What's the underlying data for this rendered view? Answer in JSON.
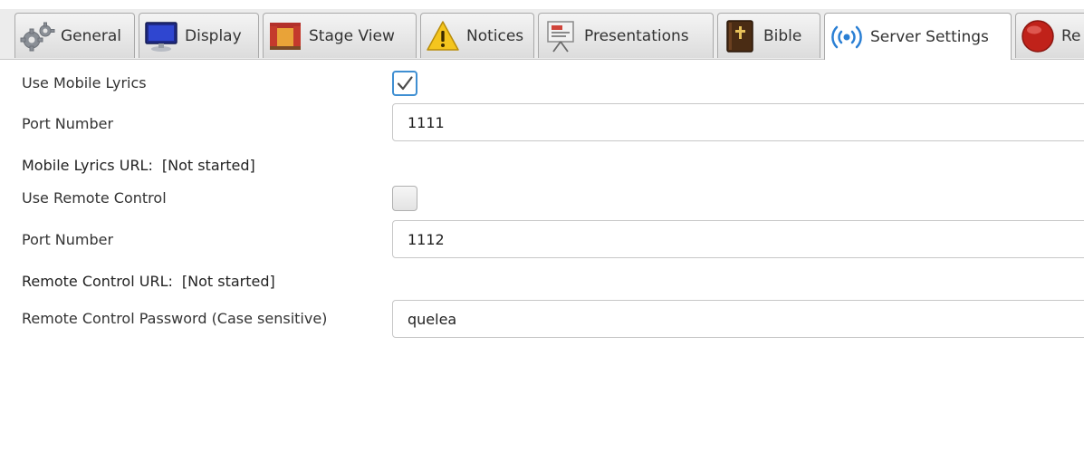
{
  "tabs": [
    {
      "label": "General",
      "icon": "gears-icon"
    },
    {
      "label": "Display",
      "icon": "monitor-icon"
    },
    {
      "label": "Stage View",
      "icon": "stage-icon"
    },
    {
      "label": "Notices",
      "icon": "warning-icon"
    },
    {
      "label": "Presentations",
      "icon": "presentation-icon"
    },
    {
      "label": "Bible",
      "icon": "bible-icon"
    },
    {
      "label": "Server Settings",
      "icon": "broadcast-icon",
      "active": true
    },
    {
      "label": "Re",
      "icon": "record-icon"
    }
  ],
  "server": {
    "use_mobile_lyrics_label": "Use Mobile Lyrics",
    "use_mobile_lyrics_checked": true,
    "mobile_port_label": "Port Number",
    "mobile_port_value": "1111",
    "mobile_url_label": "Mobile Lyrics URL:",
    "mobile_url_value": "[Not started]",
    "use_remote_control_label": "Use Remote Control",
    "use_remote_control_checked": false,
    "remote_port_label": "Port Number",
    "remote_port_value": "1112",
    "remote_url_label": "Remote Control URL:",
    "remote_url_value": "[Not started]",
    "remote_password_label": "Remote Control Password (Case sensitive)",
    "remote_password_value": "quelea"
  },
  "colors": {
    "accent": "#3f8fd2",
    "tab_bar": "#ececec",
    "broadcast_icon": "#2a7fd4",
    "record_icon": "#c0221a"
  }
}
